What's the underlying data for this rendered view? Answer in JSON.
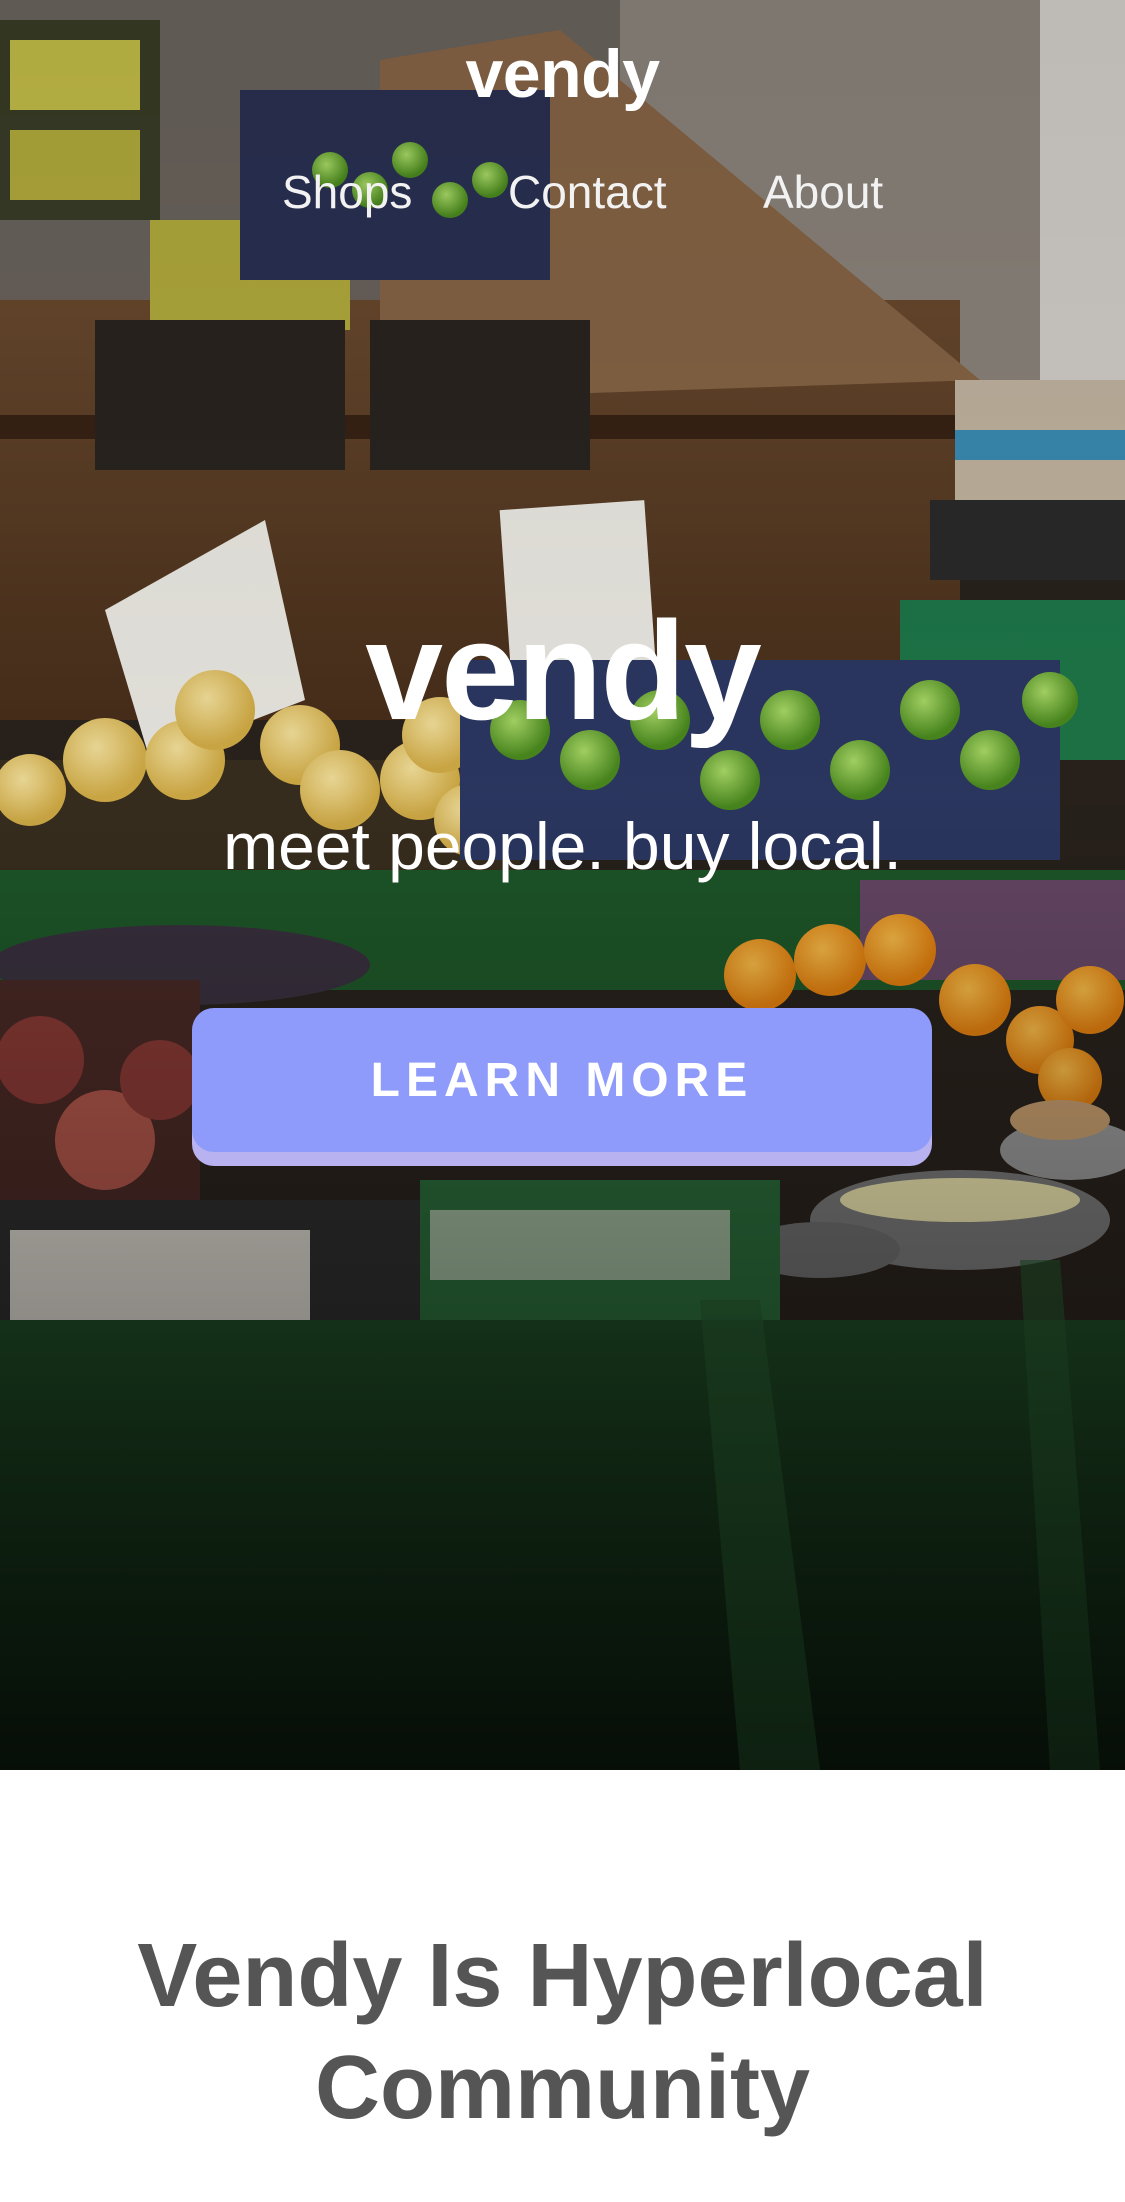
{
  "header": {
    "brand": "vendy",
    "nav": [
      {
        "label": "Shops"
      },
      {
        "label": "Contact"
      },
      {
        "label": "About"
      }
    ]
  },
  "hero": {
    "title": "vendy",
    "tagline": "meet people. buy local.",
    "cta_label": "LEARN MORE"
  },
  "section": {
    "title": "Vendy Is Hyperlocal Community"
  },
  "colors": {
    "cta_background": "#8e9bfa",
    "cta_shadow": "#b8b2f0",
    "heading_gray": "#555555",
    "text_on_image": "#ffffff"
  }
}
